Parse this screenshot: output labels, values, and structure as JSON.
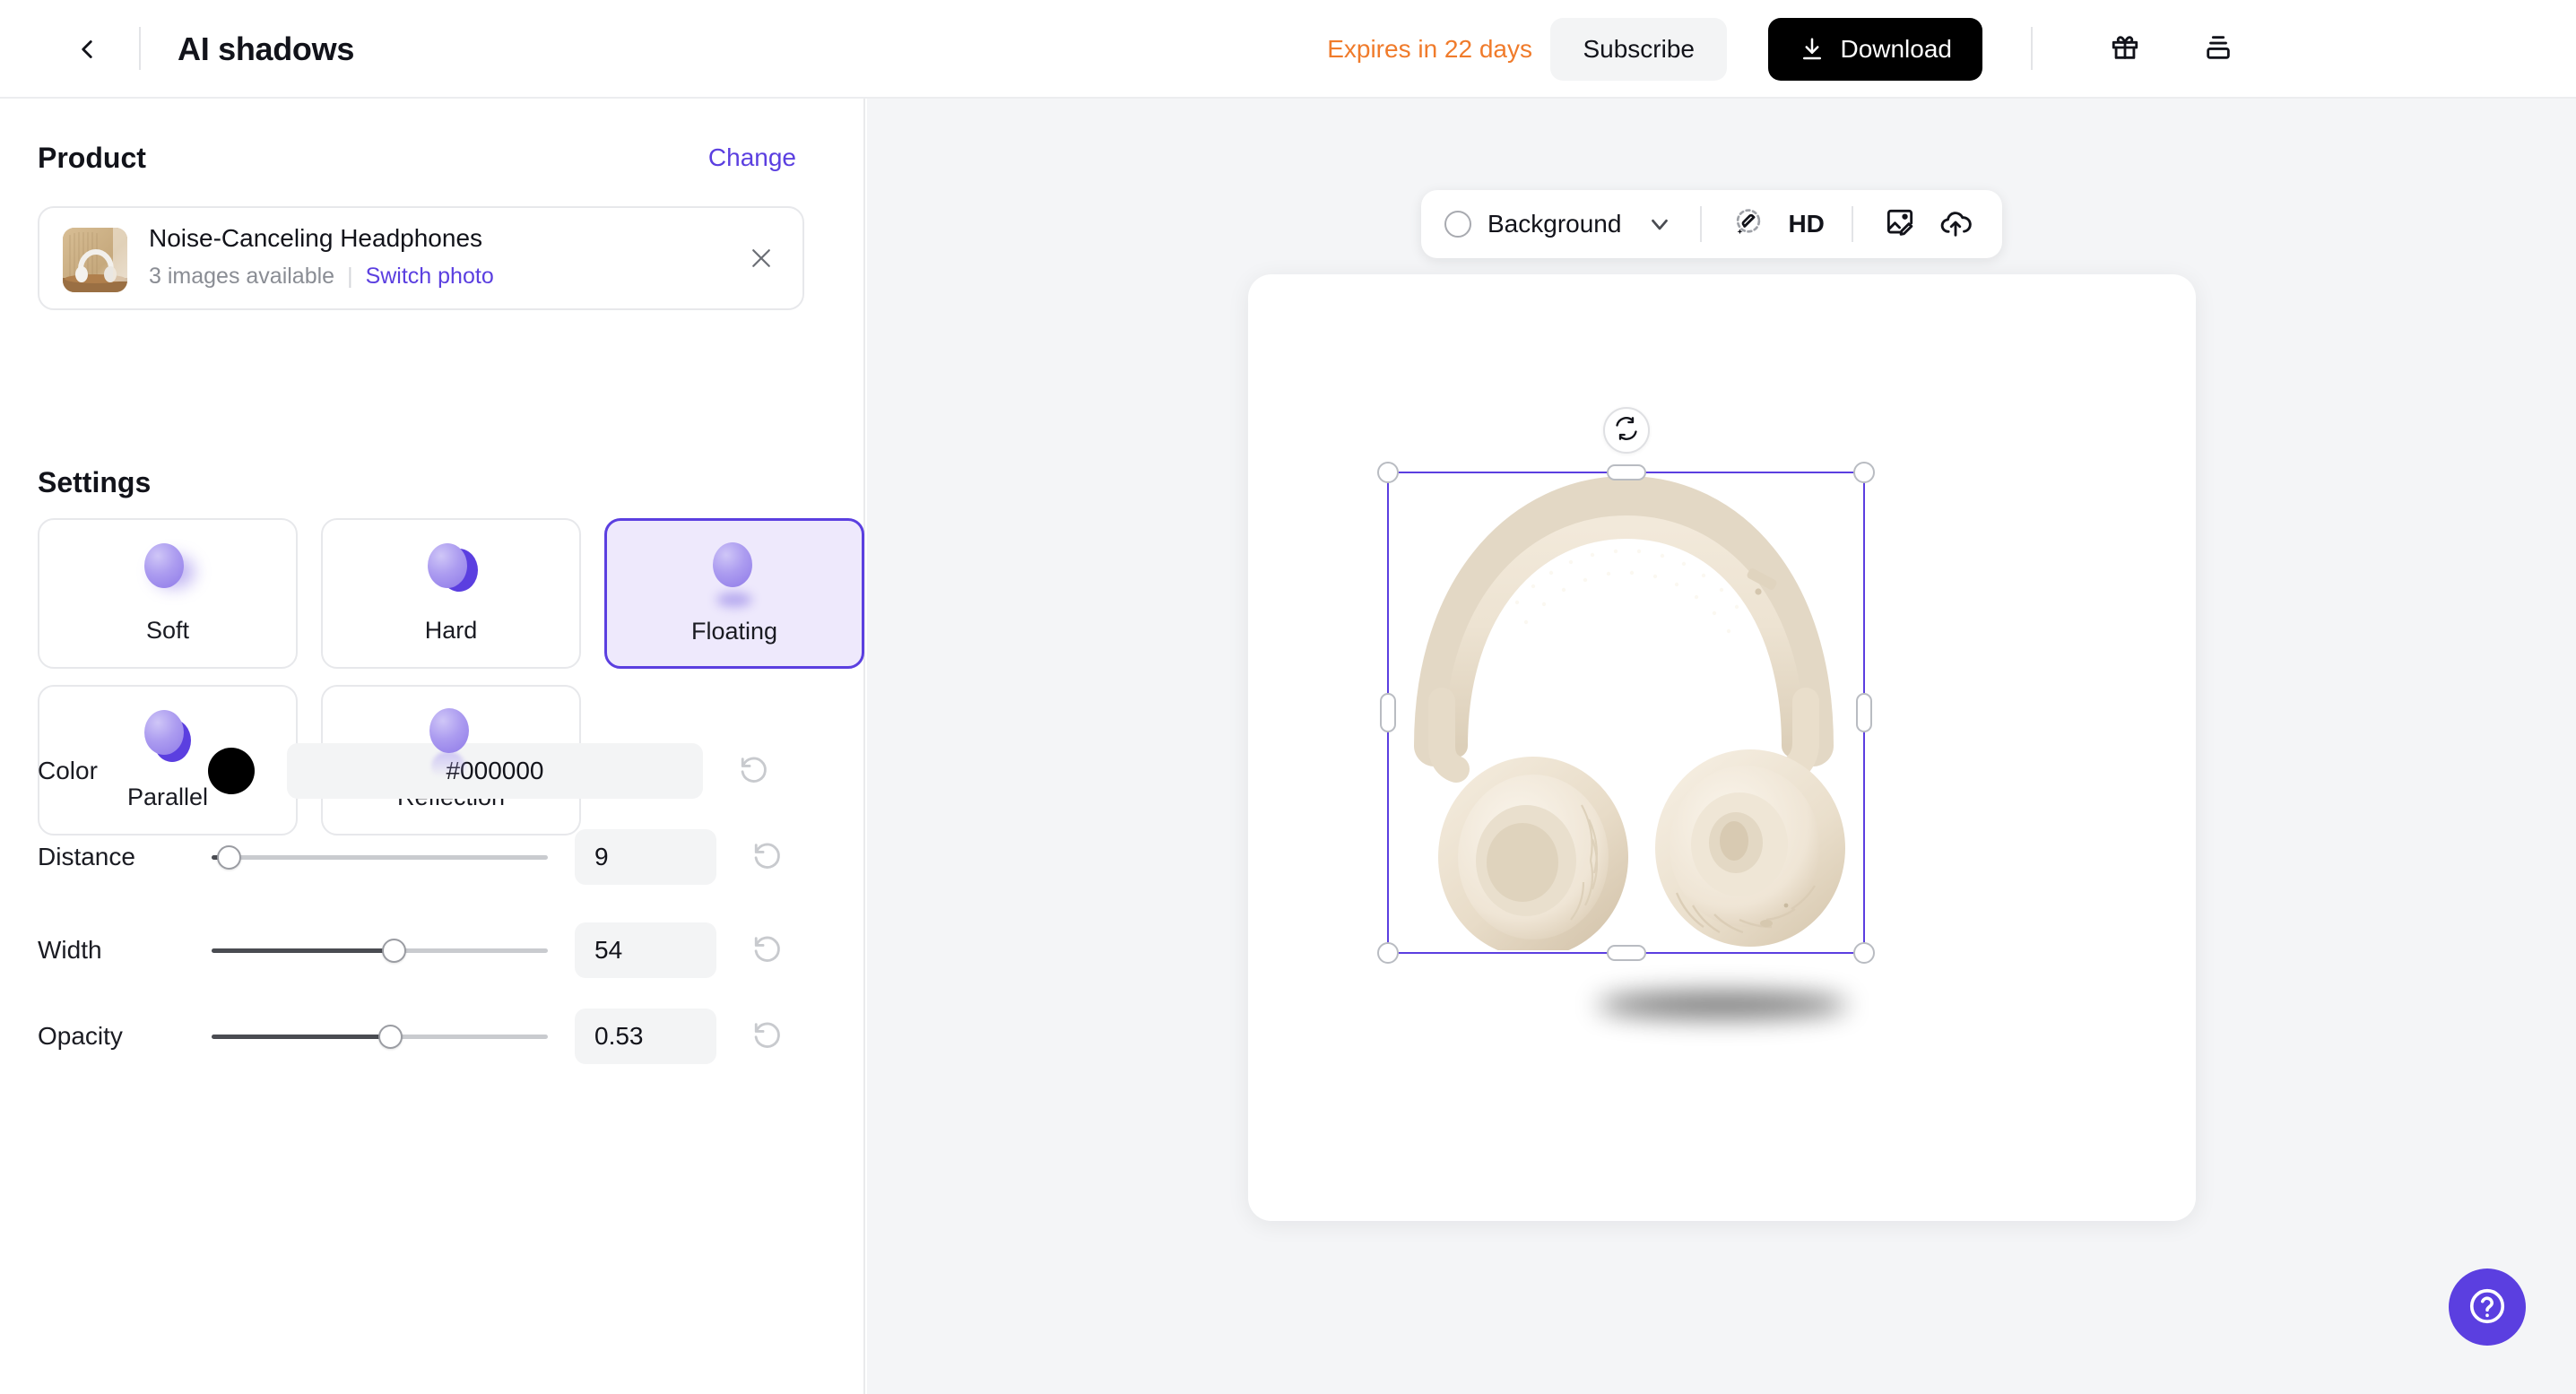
{
  "header": {
    "back_icon": "chevron-left-icon",
    "title": "AI shadows",
    "expires_text": "Expires in 22 days",
    "subscribe_label": "Subscribe",
    "download_label": "Download",
    "download_icon": "download-icon",
    "gift_icon": "gift-icon",
    "layers_icon": "layers-icon",
    "accent_orange": "#F07B2B",
    "download_bg": "#000000"
  },
  "sidebar": {
    "product_section": {
      "heading": "Product",
      "change_label": "Change",
      "card": {
        "thumbnail_icon": "product-thumbnail",
        "name": "Noise-Canceling Headphones",
        "images_available": "3 images available",
        "separator": "|",
        "switch_photo_label": "Switch photo",
        "close_icon": "close-icon"
      }
    },
    "settings_section": {
      "heading": "Settings",
      "styles": [
        {
          "label": "Soft",
          "icon": "shadow-soft-icon",
          "selected": false
        },
        {
          "label": "Hard",
          "icon": "shadow-hard-icon",
          "selected": false
        },
        {
          "label": "Floating",
          "icon": "shadow-floating-icon",
          "selected": true
        },
        {
          "label": "Parallel",
          "icon": "shadow-parallel-icon",
          "selected": false
        },
        {
          "label": "Reflection",
          "icon": "shadow-reflection-icon",
          "selected": false
        }
      ],
      "selected_style": "Floating",
      "accent_purple": "#5B3FE0",
      "selected_bg": "#EEE9FC"
    },
    "controls": {
      "color": {
        "label": "Color",
        "swatch_color": "#000000",
        "value": "#000000",
        "placeholder": "#000000",
        "reset_icon": "reset-icon"
      },
      "distance": {
        "label": "Distance",
        "value": "9",
        "fill_percent": 5,
        "reset_icon": "reset-icon"
      },
      "width": {
        "label": "Width",
        "value": "54",
        "fill_percent": 54,
        "reset_icon": "reset-icon"
      },
      "opacity": {
        "label": "Opacity",
        "value": "0.53",
        "fill_percent": 53,
        "reset_icon": "reset-icon"
      }
    }
  },
  "canvas": {
    "toolbar": {
      "bg_circle_icon": "color-circle-icon",
      "background_label": "Background",
      "chevron_icon": "chevron-down-icon",
      "magic_eraser_icon": "magic-eraser-icon",
      "hd_label": "HD",
      "image_edit_icon": "image-edit-icon",
      "cloud_upload_icon": "cloud-upload-icon"
    },
    "selection": {
      "rotate_icon": "rotate-icon",
      "frame_color": "#5B3FE0"
    },
    "product_image_alt": "Noise-Canceling Headphones",
    "shadow": {
      "style": "Floating",
      "color": "#000000",
      "opacity": "0.53"
    },
    "background_color": "#F4F5F7"
  },
  "help": {
    "icon": "help-circle-icon",
    "bg_color": "#5B3FE0"
  }
}
